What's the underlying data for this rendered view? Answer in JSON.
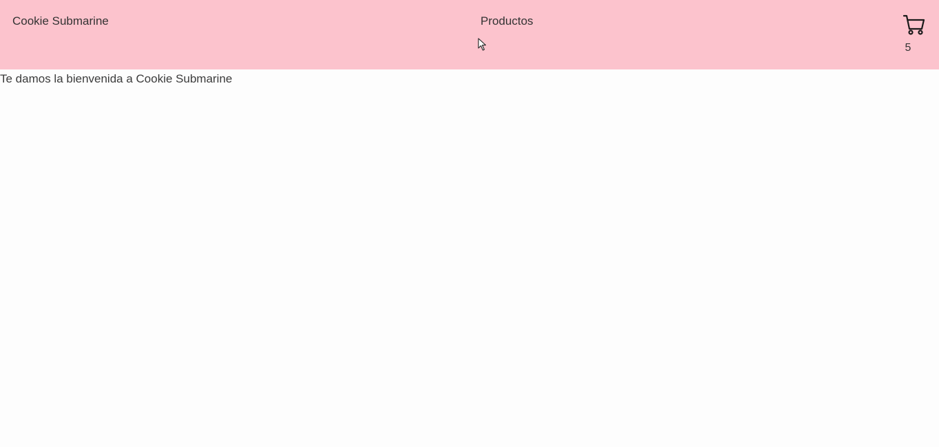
{
  "navbar": {
    "brand": "Cookie Submarine",
    "link": "Productos",
    "cart": {
      "icon": "cart-icon",
      "count": "5"
    },
    "background": "#fcc3cd"
  },
  "main": {
    "welcome": "Te damos la bienvenida a Cookie Submarine"
  }
}
